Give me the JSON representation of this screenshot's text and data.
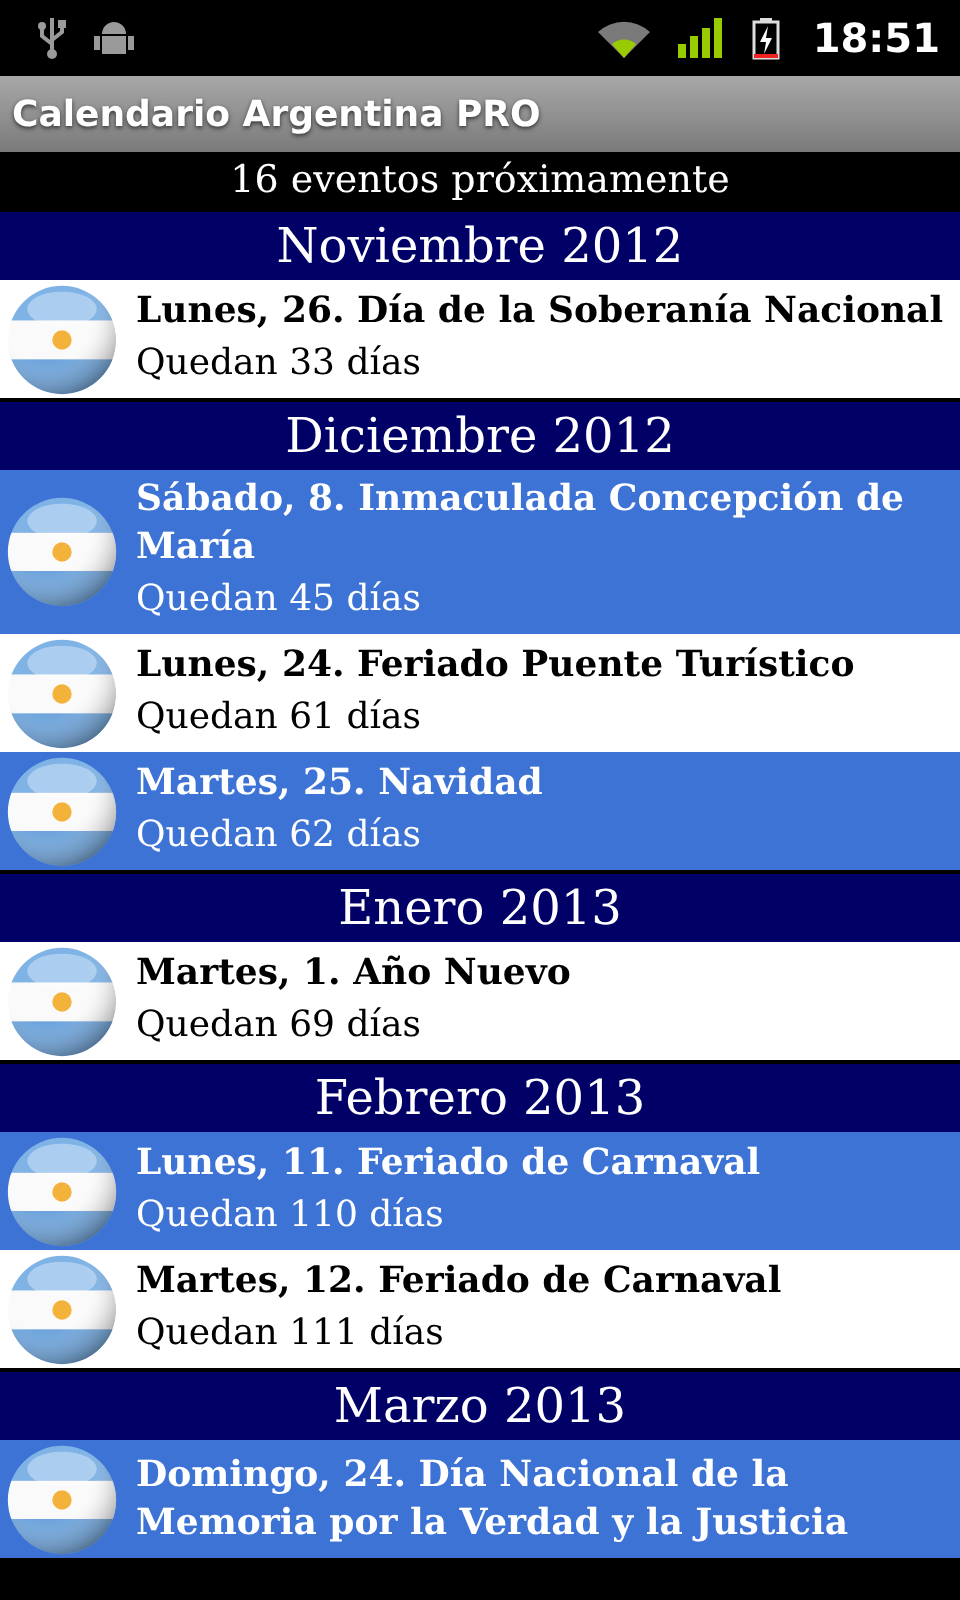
{
  "status_bar": {
    "time": "18:51"
  },
  "app_bar": {
    "title": "Calendario Argentina PRO"
  },
  "summary": "16 eventos próximamente",
  "months": [
    {
      "title": "Noviembre 2012",
      "events": [
        {
          "title": "Lunes, 26. Día de la Soberanía Nacional",
          "remaining": "Quedan 33 días",
          "shaded": false
        }
      ]
    },
    {
      "title": "Diciembre 2012",
      "events": [
        {
          "title": "Sábado, 8. Inmaculada Concepción de María",
          "remaining": "Quedan 45 días",
          "shaded": true
        },
        {
          "title": "Lunes, 24. Feriado Puente Turístico",
          "remaining": "Quedan 61 días",
          "shaded": false
        },
        {
          "title": "Martes, 25. Navidad",
          "remaining": "Quedan 62 días",
          "shaded": true
        }
      ]
    },
    {
      "title": "Enero 2013",
      "events": [
        {
          "title": "Martes, 1. Año Nuevo",
          "remaining": "Quedan 69 días",
          "shaded": false
        }
      ]
    },
    {
      "title": "Febrero 2013",
      "events": [
        {
          "title": "Lunes, 11. Feriado de Carnaval",
          "remaining": "Quedan 110 días",
          "shaded": true
        },
        {
          "title": "Martes, 12. Feriado de Carnaval",
          "remaining": "Quedan 111 días",
          "shaded": false
        }
      ]
    },
    {
      "title": "Marzo 2013",
      "events": [
        {
          "title": "Domingo, 24. Día Nacional de la Memoria por la Verdad y la Justicia",
          "shaded": true
        }
      ]
    }
  ]
}
